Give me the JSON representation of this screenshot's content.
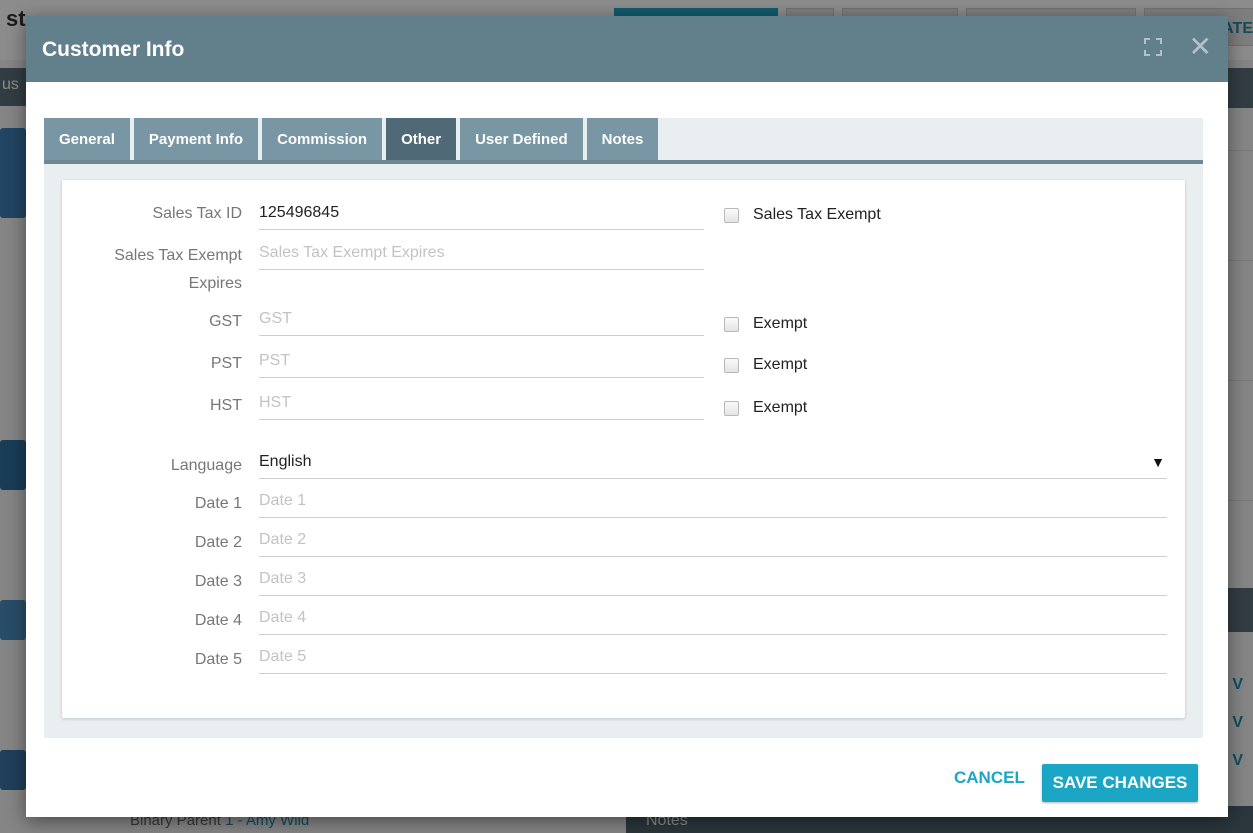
{
  "background": {
    "title_fragment": "st",
    "corner_text": "IATE",
    "left_tab_fragment": "us",
    "bottom_left_label": "Binary Parent",
    "bottom_left_link": "1 - Amy Wild",
    "bottom_right_heading": "Notes",
    "right_links": [
      "V",
      "V",
      "V"
    ]
  },
  "modal": {
    "title": "Customer Info",
    "expand_icon": "expand-icon",
    "close_icon": "close-icon",
    "close_glyph": "✕"
  },
  "tabs": [
    {
      "label": "General",
      "active": false
    },
    {
      "label": "Payment Info",
      "active": false
    },
    {
      "label": "Commission",
      "active": false
    },
    {
      "label": "Other",
      "active": true
    },
    {
      "label": "User Defined",
      "active": false
    },
    {
      "label": "Notes",
      "active": false
    }
  ],
  "form": {
    "sales_tax_id": {
      "label": "Sales Tax ID",
      "value": "125496845",
      "placeholder": "Sales Tax ID"
    },
    "sales_tax_exempt": {
      "label": "Sales Tax Exempt",
      "checked": false
    },
    "sales_tax_exempt_expires": {
      "label_line1": "Sales Tax Exempt",
      "label_line2": "Expires",
      "value": "",
      "placeholder": "Sales Tax Exempt Expires"
    },
    "gst": {
      "label": "GST",
      "value": "",
      "placeholder": "GST",
      "exempt_label": "Exempt",
      "exempt_checked": false
    },
    "pst": {
      "label": "PST",
      "value": "",
      "placeholder": "PST",
      "exempt_label": "Exempt",
      "exempt_checked": false
    },
    "hst": {
      "label": "HST",
      "value": "",
      "placeholder": "HST",
      "exempt_label": "Exempt",
      "exempt_checked": false
    },
    "language": {
      "label": "Language",
      "selected": "English",
      "arrow_glyph": "▼"
    },
    "date1": {
      "label": "Date 1",
      "value": "",
      "placeholder": "Date 1"
    },
    "date2": {
      "label": "Date 2",
      "value": "",
      "placeholder": "Date 2"
    },
    "date3": {
      "label": "Date 3",
      "value": "",
      "placeholder": "Date 3"
    },
    "date4": {
      "label": "Date 4",
      "value": "",
      "placeholder": "Date 4"
    },
    "date5": {
      "label": "Date 5",
      "value": "",
      "placeholder": "Date 5"
    }
  },
  "footer": {
    "cancel_label": "CANCEL",
    "save_label": "SAVE CHANGES"
  },
  "colors": {
    "header": "#627f8c",
    "tab": "#7896a3",
    "tab_active": "#4f6a76",
    "accent": "#1ba6c6"
  }
}
